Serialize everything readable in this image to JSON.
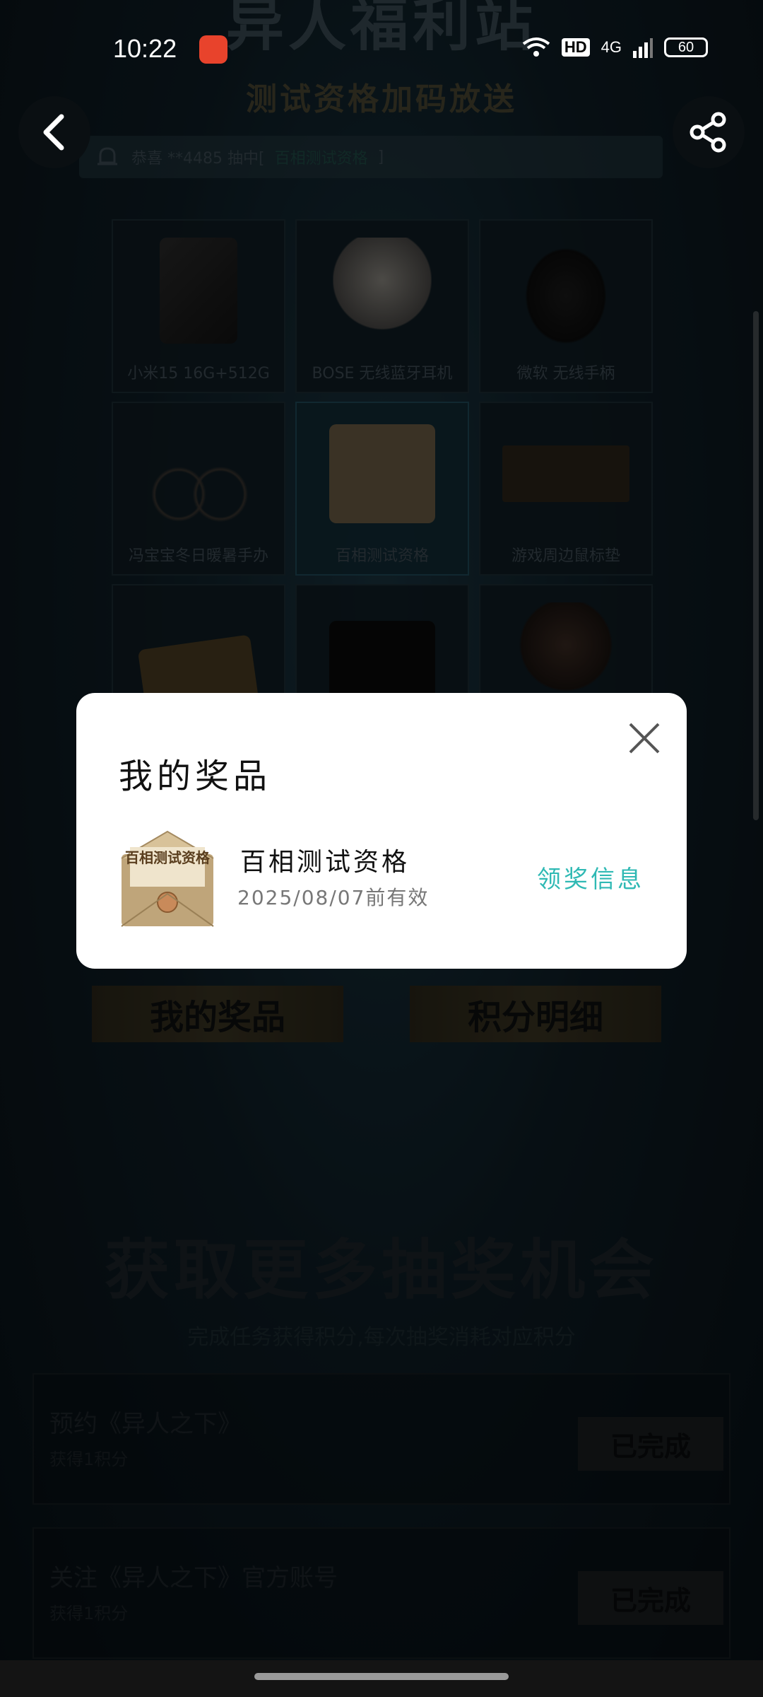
{
  "status_bar": {
    "time": "10:22",
    "network": "4G",
    "hd": "HD",
    "battery": "60"
  },
  "header": {
    "title": "异人福利站",
    "subtitle": "测试资格加码放送"
  },
  "notice": {
    "prefix": "恭喜 **4485 抽中[",
    "prize": "百相测试资格",
    "suffix": "]"
  },
  "prizes": [
    {
      "label": "小米15 16G+512G",
      "icon": "phone-icon"
    },
    {
      "label": "BOSE 无线蓝牙耳机",
      "icon": "headphones-icon"
    },
    {
      "label": "微软 无线手柄",
      "icon": "gamepad-icon"
    },
    {
      "label": "冯宝宝冬日暖暑手办",
      "icon": "figure-bike-icon"
    },
    {
      "label": "百相测试资格",
      "icon": "envelope-icon"
    },
    {
      "label": "游戏周边鼠标垫",
      "icon": "mousepad-icon"
    },
    {
      "label": "",
      "icon": "cards-icon"
    },
    {
      "label": "",
      "icon": "tshirt-icon"
    },
    {
      "label": "",
      "icon": "figure-icon"
    }
  ],
  "buttons": {
    "my_prizes": "我的奖品",
    "points_detail": "积分明细"
  },
  "more_chances": {
    "title": "获取更多抽奖机会",
    "subtitle": "完成任务获得积分,每次抽奖消耗对应积分"
  },
  "tasks": [
    {
      "title": "预约《异人之下》",
      "desc": "获得1积分",
      "status": "已完成"
    },
    {
      "title": "关注《异人之下》官方账号",
      "desc": "获得1积分",
      "status": "已完成"
    }
  ],
  "modal": {
    "title": "我的奖品",
    "prize_name": "百相测试资格",
    "expiry": "2025/08/07前有效",
    "claim_label": "领奖信息",
    "envelope_text": "百相测试资格"
  },
  "colors": {
    "accent": "#2fb9b4",
    "background": "#0e1d25"
  }
}
